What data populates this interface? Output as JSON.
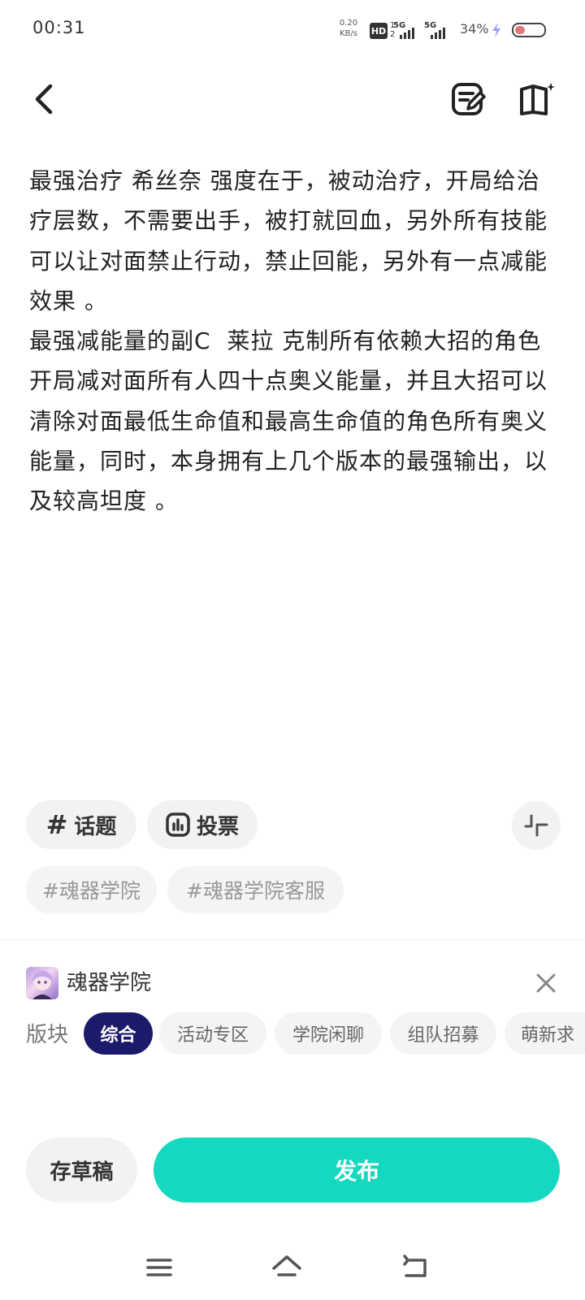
{
  "status_bar": {
    "time": "00:31",
    "net_speed_value": "0.20",
    "net_speed_unit": "KB/s",
    "hd_label": "HD",
    "hd_sub_top": "1",
    "hd_sub_bottom": "2",
    "signal1_label": "5G",
    "signal2_label": "5G",
    "battery_percent": "34%",
    "battery_level": 0.34,
    "battery_color": "#e0777a"
  },
  "header": {
    "back_icon": "chevron-left-icon",
    "edit_icon": "edit-note-icon",
    "book_icon": "book-sparkle-icon"
  },
  "post": {
    "body": "最强治疗 希丝奈 强度在于，被动治疗，开局给治疗层数，不需要出手，被打就回血，另外所有技能可以让对面禁止行动，禁止回能，另外有一点减能效果 。\n最强减能量的副C  莱拉 克制所有依赖大招的角色开局减对面所有人四十点奥义能量，并且大招可以清除对面最低生命值和最高生命值的角色所有奥义能量，同时，本身拥有上几个版本的最强输出，以及较高坦度 。"
  },
  "tools": {
    "topic_icon": "#",
    "topic_label": "话题",
    "vote_label": "投票",
    "collapse_icon": "collapse-icon"
  },
  "tags": [
    "#魂器学院",
    "#魂器学院客服"
  ],
  "community": {
    "name": "魂器学院",
    "board_label": "版块",
    "boards": [
      "综合",
      "活动专区",
      "学院闲聊",
      "组队招募",
      "萌新求"
    ],
    "active_board": "综合"
  },
  "actions": {
    "draft_label": "存草稿",
    "publish_label": "发布",
    "publish_color": "#14d8c0",
    "active_board_color": "#1c1a6b"
  },
  "nav_bar": [
    "menu-icon",
    "home-icon",
    "back-icon"
  ]
}
